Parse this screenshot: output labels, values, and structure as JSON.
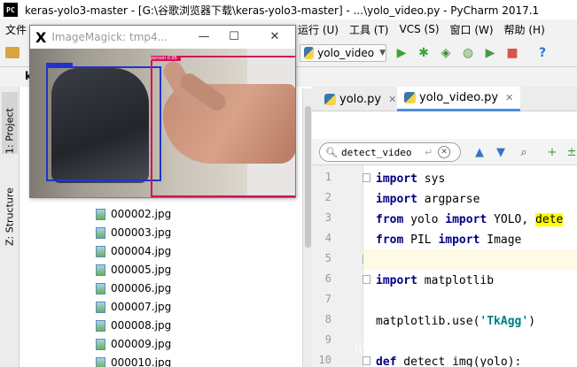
{
  "window": {
    "app_icon": "PC",
    "title": "keras-yolo3-master - [G:\\谷歌浏览器下载\\keras-yolo3-master] - ...\\yolo_video.py - PyCharm 2017.1"
  },
  "menubar": {
    "left_items": [
      "文件"
    ],
    "right_items": [
      "运行 (U)",
      "工具 (T)",
      "VCS (S)",
      "窗口 (W)",
      "帮助 (H)"
    ]
  },
  "toolbar": {
    "run_config": "yolo_video",
    "icons": [
      "run-icon",
      "debug-icon",
      "coverage-icon",
      "profile-icon",
      "concurrency-icon",
      "stop-icon",
      "help-icon"
    ]
  },
  "breadcrumb": "k",
  "left_strip": {
    "tabs": [
      "1: Project",
      "Z: Structure"
    ]
  },
  "project_files": [
    "000002.jpg",
    "000003.jpg",
    "000004.jpg",
    "000005.jpg",
    "000006.jpg",
    "000007.jpg",
    "000008.jpg",
    "000009.jpg",
    "000010.jpg"
  ],
  "editor": {
    "tabs": [
      {
        "label": "yolo.py",
        "active": false
      },
      {
        "label": "yolo_video.py",
        "active": true
      }
    ],
    "find": {
      "value": "detect_video",
      "enter_glyph": "↵"
    },
    "line_numbers": [
      "1",
      "2",
      "3",
      "4",
      "5",
      "6",
      "7",
      "8",
      "9",
      "10"
    ],
    "code": {
      "l1_kw": "import",
      "l1_rest": " sys",
      "l2_kw": "import",
      "l2_rest": " argparse",
      "l3_kw1": "from",
      "l3_mid": " yolo ",
      "l3_kw2": "import",
      "l3_rest": " YOLO, ",
      "l3_hl": "dete",
      "l4_kw1": "from",
      "l4_mid": " PIL ",
      "l4_kw2": "import",
      "l4_rest": " Image",
      "l6_kw": "import",
      "l6_rest": " matplotlib",
      "l8_pre": "matplotlib.use(",
      "l8_str": "'TkAgg'",
      "l8_post": ")",
      "l10_kw": "def",
      "l10_rest": " detect_img(yolo):"
    }
  },
  "watermark": "https://blog.csdn.net/qq_35189360",
  "imagemagick": {
    "title": "ImageMagick: tmp4...",
    "box_blue_color": "#2233cc",
    "box_red_color": "#d0145a",
    "red_tag_text": "person 0.95"
  },
  "colors": {
    "keyword": "#000080",
    "string": "#008080",
    "search_highlight": "#ffff00",
    "active_tab_underline": "#4c8ce0"
  }
}
